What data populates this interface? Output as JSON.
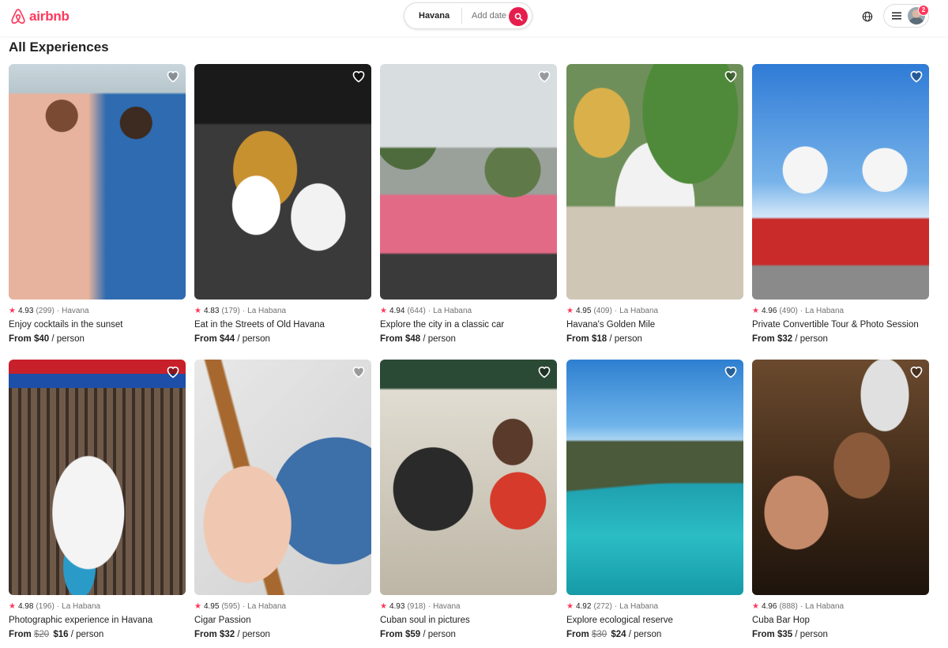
{
  "brand": {
    "name": "airbnb",
    "color": "#FF385C"
  },
  "search": {
    "location": "Havana",
    "date_placeholder": "Add date",
    "icon": "search-icon"
  },
  "header": {
    "globe_icon": "globe-icon",
    "menu_icon": "hamburger-icon",
    "notifications": "2"
  },
  "page_title": "All Experiences",
  "labels": {
    "from": "From",
    "per_person": "/ person"
  },
  "rows": [
    [
      {
        "rating": "4.93",
        "count": "(299)",
        "location": "Havana",
        "title": "Enjoy cocktails in the sunset",
        "price": "$40",
        "old_price": null
      },
      {
        "rating": "4.83",
        "count": "(179)",
        "location": "La Habana",
        "title": "Eat in the Streets of Old Havana",
        "price": "$44",
        "old_price": null
      },
      {
        "rating": "4.94",
        "count": "(644)",
        "location": "La Habana",
        "title": "Explore the city in a classic car",
        "price": "$48",
        "old_price": null
      },
      {
        "rating": "4.95",
        "count": "(409)",
        "location": "La Habana",
        "title": "Havana's Golden Mile",
        "price": "$18",
        "old_price": null
      },
      {
        "rating": "4.96",
        "count": "(490)",
        "location": "La Habana",
        "title": "Private Convertible Tour & Photo Session",
        "price": "$32",
        "old_price": null
      }
    ],
    [
      {
        "rating": "4.98",
        "count": "(196)",
        "location": "La Habana",
        "title": "Photographic experience in Havana",
        "price": "$16",
        "old_price": "$20"
      },
      {
        "rating": "4.95",
        "count": "(595)",
        "location": "La Habana",
        "title": "Cigar Passion",
        "price": "$32",
        "old_price": null
      },
      {
        "rating": "4.93",
        "count": "(918)",
        "location": "Havana",
        "title": "Cuban soul in pictures",
        "price": "$59",
        "old_price": null
      },
      {
        "rating": "4.92",
        "count": "(272)",
        "location": "La Habana",
        "title": "Explore ecological reserve",
        "price": "$24",
        "old_price": "$30"
      },
      {
        "rating": "4.96",
        "count": "(888)",
        "location": "La Habana",
        "title": "Cuba Bar Hop",
        "price": "$35",
        "old_price": null
      }
    ]
  ]
}
